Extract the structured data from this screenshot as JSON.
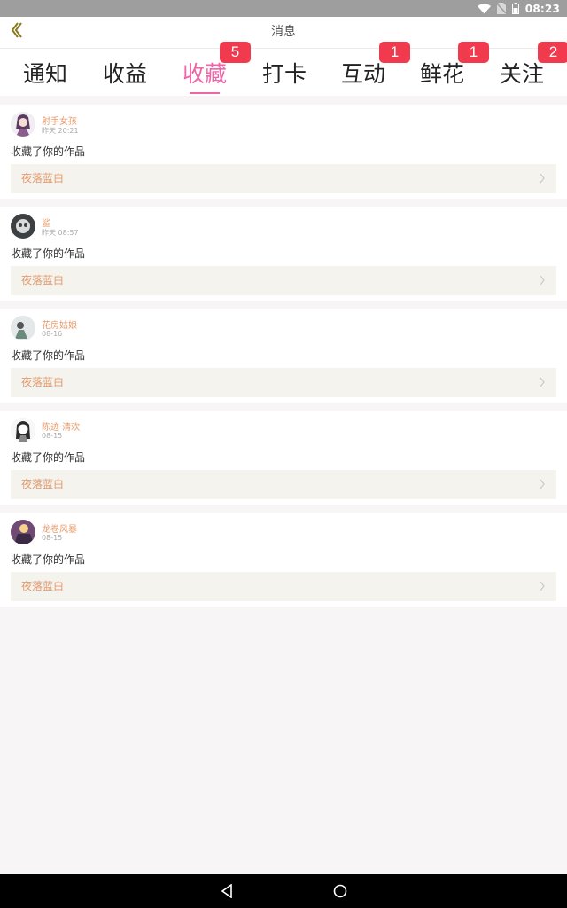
{
  "status_bar": {
    "time": "08:23"
  },
  "header": {
    "title": "消息"
  },
  "tabs": [
    {
      "label": "通知",
      "badge": ""
    },
    {
      "label": "收益",
      "badge": ""
    },
    {
      "label": "收藏",
      "badge": "5",
      "active": true
    },
    {
      "label": "打卡",
      "badge": ""
    },
    {
      "label": "互动",
      "badge": "1"
    },
    {
      "label": "鲜花",
      "badge": "1"
    },
    {
      "label": "关注",
      "badge": "2"
    }
  ],
  "items": [
    {
      "username": "射手女孩",
      "time": "昨天 20:21",
      "action": "收藏了你的作品",
      "work": "夜落蓝白"
    },
    {
      "username": "鲨",
      "time": "昨天 08:57",
      "action": "收藏了你的作品",
      "work": "夜落蓝白"
    },
    {
      "username": "花房姑娘",
      "time": "08-16",
      "action": "收藏了你的作品",
      "work": "夜落蓝白"
    },
    {
      "username": "陈迹·清欢",
      "time": "08-15",
      "action": "收藏了你的作品",
      "work": "夜落蓝白"
    },
    {
      "username": "龙卷风暴",
      "time": "08-15",
      "action": "收藏了你的作品",
      "work": "夜落蓝白"
    }
  ],
  "colors": {
    "accent": "#ee66a8",
    "badge": "#f23a4f",
    "username": "#e79a6a",
    "work_title": "#e39a6d"
  }
}
